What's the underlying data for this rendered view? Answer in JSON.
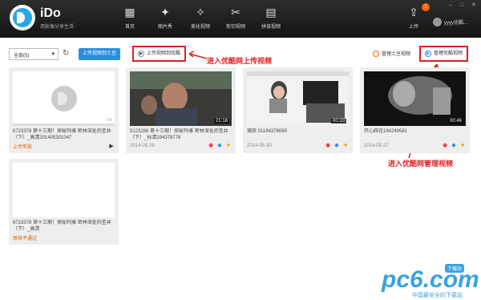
{
  "header": {
    "brand": "iDo",
    "tagline": "用影像分享生活",
    "nav": [
      {
        "label": "首页",
        "icon": "grid-icon"
      },
      {
        "label": "图片秀",
        "icon": "figure-icon"
      },
      {
        "label": "美化视频",
        "icon": "magic-wand-icon"
      },
      {
        "label": "剪切视频",
        "icon": "scissors-icon"
      },
      {
        "label": "拼接视频",
        "icon": "film-icon"
      }
    ],
    "upload_label": "上传",
    "upload_badge": "1",
    "user_name": "yyyy优酷..."
  },
  "toolbar": {
    "filter_value": "全部(5)",
    "upload_tudou_label": "上传视频到土豆",
    "upload_youku_label": "上传视频到优酷",
    "manage_tudou_label": "管理土豆视频",
    "manage_youku_label": "管理优酷视频"
  },
  "annotations": {
    "upload": "进入优酷网上传视频",
    "manage": "进入优酷网管理视频"
  },
  "videos": [
    {
      "title": "6723378 第十三期！探秘玛雅 密林深处的圣井（下）_高清201405301047",
      "meta": "上传失败",
      "duration": "",
      "progress": "1%"
    },
    {
      "title": "5123286 第十三期！探秘玛雅 密林深处的圣井（下）_标清194378778",
      "meta": "2014-05-29",
      "duration": "21:18"
    },
    {
      "title": "捕获 01194378085",
      "meta": "2014-05-30",
      "duration": "00:33"
    },
    {
      "title": "开心踩花194249581",
      "meta": "2014-05-27",
      "duration": "00:46"
    },
    {
      "title": "6723378 第十三期！探秘玛雅 密林深处的圣井（下）_高清",
      "meta": "审核不通过",
      "duration": ""
    }
  ],
  "watermark": {
    "text": "pc6.com",
    "sub": "中国最安全的下载站",
    "badge": "下载站"
  }
}
